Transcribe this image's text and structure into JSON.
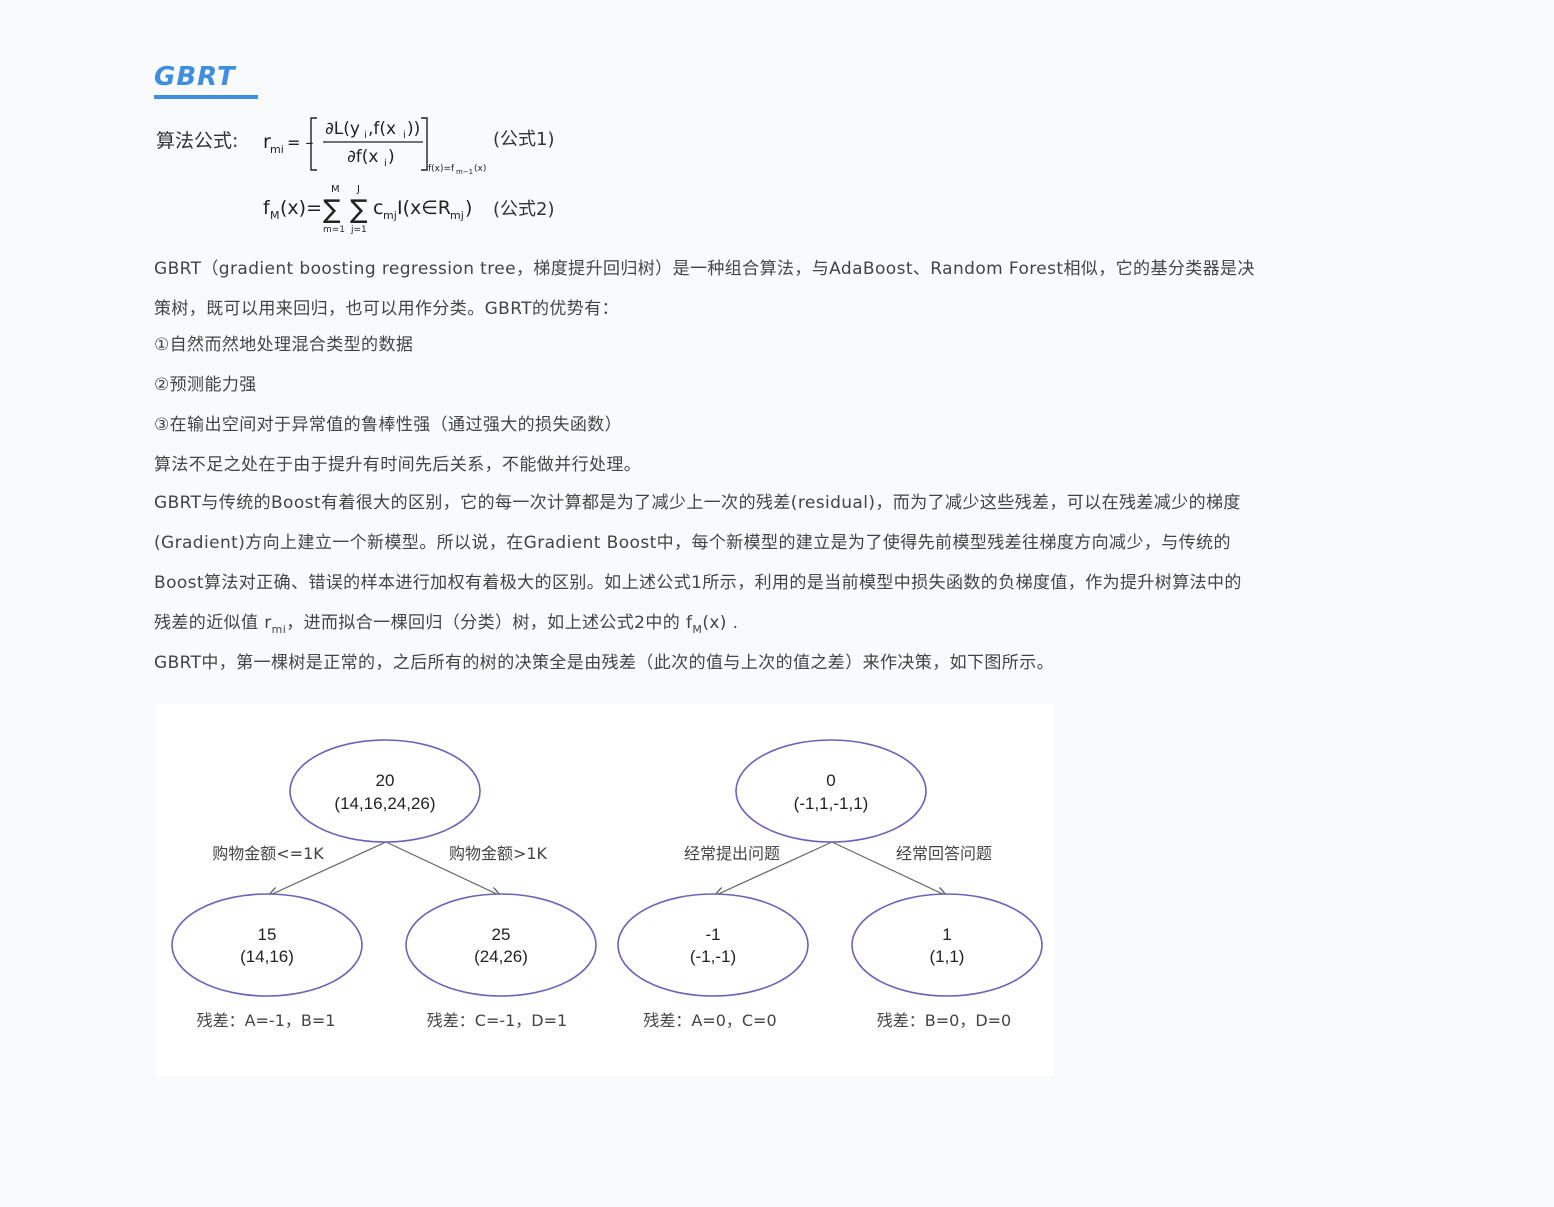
{
  "title": "GBRT",
  "formula": {
    "label": "算法公式:",
    "eq1_tag": "(公式1)",
    "eq2_tag": "(公式2)"
  },
  "paragraphs": {
    "p1_line1": "GBRT（gradient boosting regression tree，梯度提升回归树）是一种组合算法，与AdaBoost、Random Forest相似，它的基分类器是决",
    "p1_line2": "策树，既可以用来回归，也可以用作分类。GBRT的优势有：",
    "adv1": "①自然而然地处理混合类型的数据",
    "adv2": "②预测能力强",
    "adv3": "③在输出空间对于异常值的鲁棒性强（通过强大的损失函数）",
    "weakness": "算法不足之处在于由于提升有时间先后关系，不能做并行处理。",
    "p2_line1": "GBRT与传统的Boost有着很大的区别，它的每一次计算都是为了减少上一次的残差(residual)，而为了减少这些残差，可以在残差减少的梯度",
    "p2_line2": "(Gradient)方向上建立一个新模型。所以说，在Gradient Boost中，每个新模型的建立是为了使得先前模型残差往梯度方向减少，与传统的",
    "p2_line3": "Boost算法对正确、错误的样本进行加权有着极大的区别。如上述公式1所示，利用的是当前模型中损失函数的负梯度值，作为提升树算法中的",
    "p2_line4_a": "残差的近似值 ",
    "p2_line4_sym1": "r",
    "p2_line4_sub1": "mi",
    "p2_line4_b": "，进而拟合一棵回归（分类）树，如上述公式2中的 ",
    "p2_line4_sym2": "f",
    "p2_line4_sub2": "M",
    "p2_line4_sym2b": "(x)",
    "p2_line4_c": " .",
    "p3": "GBRT中，第一棵树是正常的，之后所有的树的决策全是由残差（此次的值与上次的值之差）来作决策，如下图所示。"
  },
  "diagram": {
    "tree1": {
      "root": {
        "value": "20",
        "set": "(14,16,24,26)"
      },
      "left_edge": "购物金额<=1K",
      "right_edge": "购物金额>1K",
      "left": {
        "value": "15",
        "set": "(14,16)",
        "residual": "残差：A=-1，B=1"
      },
      "right": {
        "value": "25",
        "set": "(24,26)",
        "residual": "残差：C=-1，D=1"
      }
    },
    "tree2": {
      "root": {
        "value": "0",
        "set": "(-1,1,-1,1)"
      },
      "left_edge": "经常提出问题",
      "right_edge": "经常回答问题",
      "left": {
        "value": "-1",
        "set": "(-1,-1)",
        "residual": "残差：A=0，C=0"
      },
      "right": {
        "value": "1",
        "set": "(1,1)",
        "residual": "残差：B=0，D=0"
      }
    }
  },
  "colors": {
    "title": "#3f8ee0",
    "node_stroke": "#6a64b4",
    "edge": "#666666"
  }
}
